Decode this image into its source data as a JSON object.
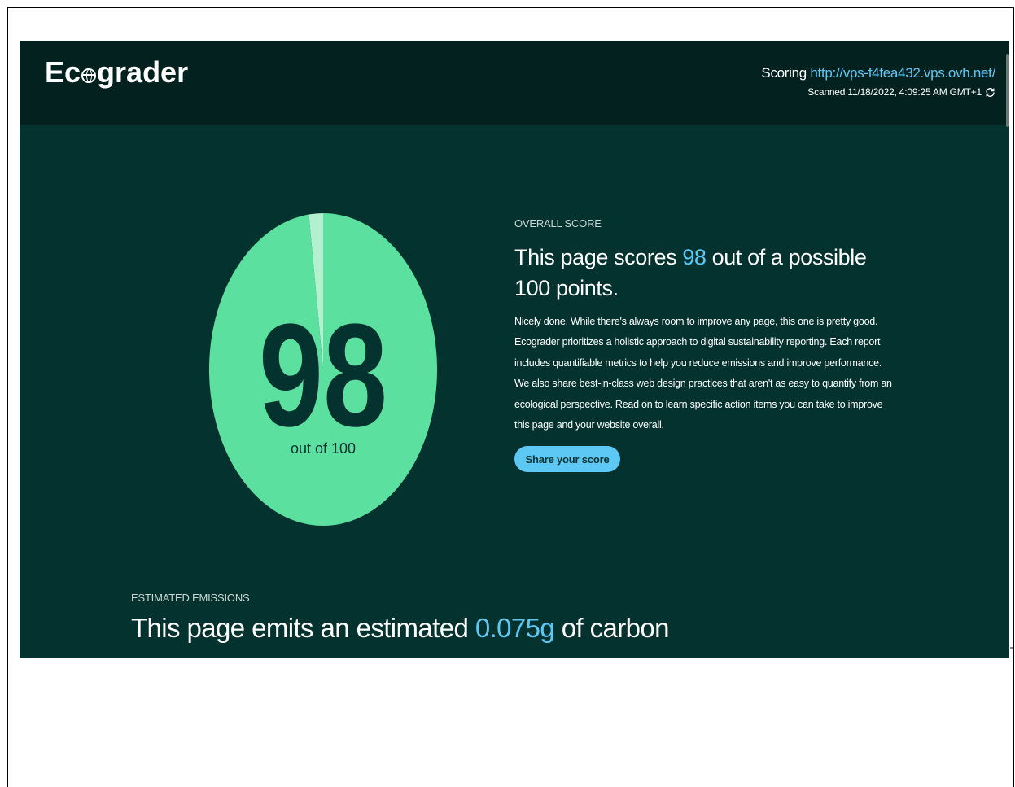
{
  "header": {
    "logo_text_pre": "Ec",
    "logo_text_post": "grader",
    "scoring_label": "Scoring",
    "scoring_url": "http://vps-f4fea432.vps.ovh.net/",
    "scanned_text": "Scanned 11/18/2022, 4:09:25 AM GMT+1"
  },
  "score": {
    "value": "98",
    "out_of_text": "out of 100",
    "fraction": 0.98,
    "fill_color": "#5ce0a0",
    "remainder_color": "#b4f0d0",
    "number_color": "#04322e"
  },
  "overall": {
    "label": "OVERALL SCORE",
    "headline_pre": "This page scores ",
    "headline_score": "98",
    "headline_post": " out of a possible 100 points.",
    "description": "Nicely done. While there's always room to improve any page, this one is pretty good. Ecograder prioritizes a holistic approach to digital sustainability reporting. Each report includes quantifiable metrics to help you reduce emissions and improve performance. We also share best-in-class web design practices that aren't as easy to quantify from an ecological perspective. Read on to learn specific action items you can take to improve this page and your website overall.",
    "share_label": "Share your score"
  },
  "emissions": {
    "label": "ESTIMATED EMISSIONS",
    "headline_pre": "This page emits an estimated ",
    "headline_value": "0.075g",
    "headline_post": " of carbon"
  },
  "colors": {
    "background": "#04322e",
    "header_background": "#03221f",
    "accent": "#5ec8f5",
    "score_green": "#5ce0a0"
  }
}
